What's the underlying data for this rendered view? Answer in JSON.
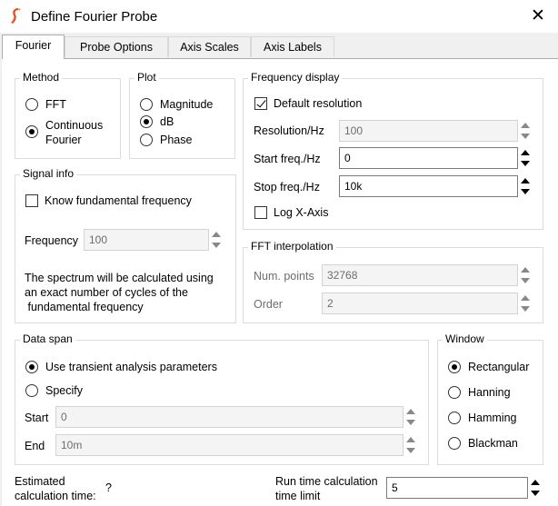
{
  "window": {
    "title": "Define Fourier Probe",
    "close_label": "✕"
  },
  "tabs": [
    {
      "label": "Fourier",
      "active": true
    },
    {
      "label": "Probe Options",
      "active": false
    },
    {
      "label": "Axis Scales",
      "active": false
    },
    {
      "label": "Axis Labels",
      "active": false
    }
  ],
  "method": {
    "title": "Method",
    "options": [
      "FFT",
      "Continuous\nFourier"
    ],
    "selected": 1
  },
  "plot": {
    "title": "Plot",
    "options": [
      "Magnitude",
      "dB",
      "Phase"
    ],
    "selected": 1
  },
  "frequency_display": {
    "title": "Frequency display",
    "default_resolution_label": "Default resolution",
    "default_resolution_checked": true,
    "resolution_label": "Resolution/Hz",
    "resolution_value": "100",
    "start_label": "Start freq./Hz",
    "start_value": "0",
    "stop_label": "Stop freq./Hz",
    "stop_value": "10k",
    "log_label": "Log X-Axis",
    "log_checked": false
  },
  "signal_info": {
    "title": "Signal info",
    "know_label": "Know fundamental frequency",
    "know_checked": false,
    "frequency_label": "Frequency",
    "frequency_value": "100",
    "note": "The spectrum will be calculated using\nan exact number of cycles of the\n fundamental frequency"
  },
  "fft_interpolation": {
    "title": "FFT interpolation",
    "points_label": "Num. points",
    "points_value": "32768",
    "order_label": "Order",
    "order_value": "2"
  },
  "data_span": {
    "title": "Data span",
    "use_transient_label": "Use transient analysis parameters",
    "specify_label": "Specify",
    "selected": 0,
    "start_label": "Start",
    "start_value": "0",
    "end_label": "End",
    "end_value": "10m"
  },
  "window_group": {
    "title": "Window",
    "options": [
      "Rectangular",
      "Hanning",
      "Hamming",
      "Blackman"
    ],
    "selected": 0
  },
  "footer": {
    "estimated_label": "Estimated\ncalculation time:",
    "estimated_value": "?",
    "run_time_label": "Run time calculation\ntime limit",
    "run_time_value": "5"
  },
  "colors": {
    "disabled_text": "#6d6d6d",
    "group_border": "#dcdcdc",
    "tab_bg": "#f0f0f0"
  }
}
